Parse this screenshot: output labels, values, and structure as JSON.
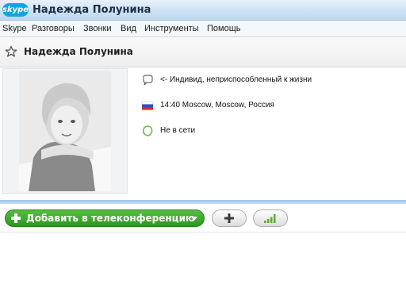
{
  "window": {
    "logo_text": "skype",
    "title": "Надежда Полунина"
  },
  "menu": [
    {
      "label": "Skype"
    },
    {
      "label": "Разговоры"
    },
    {
      "label": "Звонки"
    },
    {
      "label": "Вид"
    },
    {
      "label": "Инструменты"
    },
    {
      "label": "Помощь"
    }
  ],
  "contact": {
    "name": "Надежда Полунина",
    "mood": "<- Индивид, неприспособленный к жизни",
    "local_time": "14:40 Moscow, Moscow, Россия",
    "status": "Не в сети"
  },
  "actions": {
    "add_conference_label": "Добавить в телеконференцию"
  },
  "icons": {
    "mood": "speech-bubble-icon",
    "location": "russia-flag-icon",
    "status": "offline-status-icon",
    "favorite": "star-icon",
    "add": "plus-icon",
    "quality": "signal-bars-icon"
  },
  "colors": {
    "accent_green": "#2b9620",
    "skype_blue": "#15a3e0",
    "divider_blue": "#9cc4ea"
  }
}
